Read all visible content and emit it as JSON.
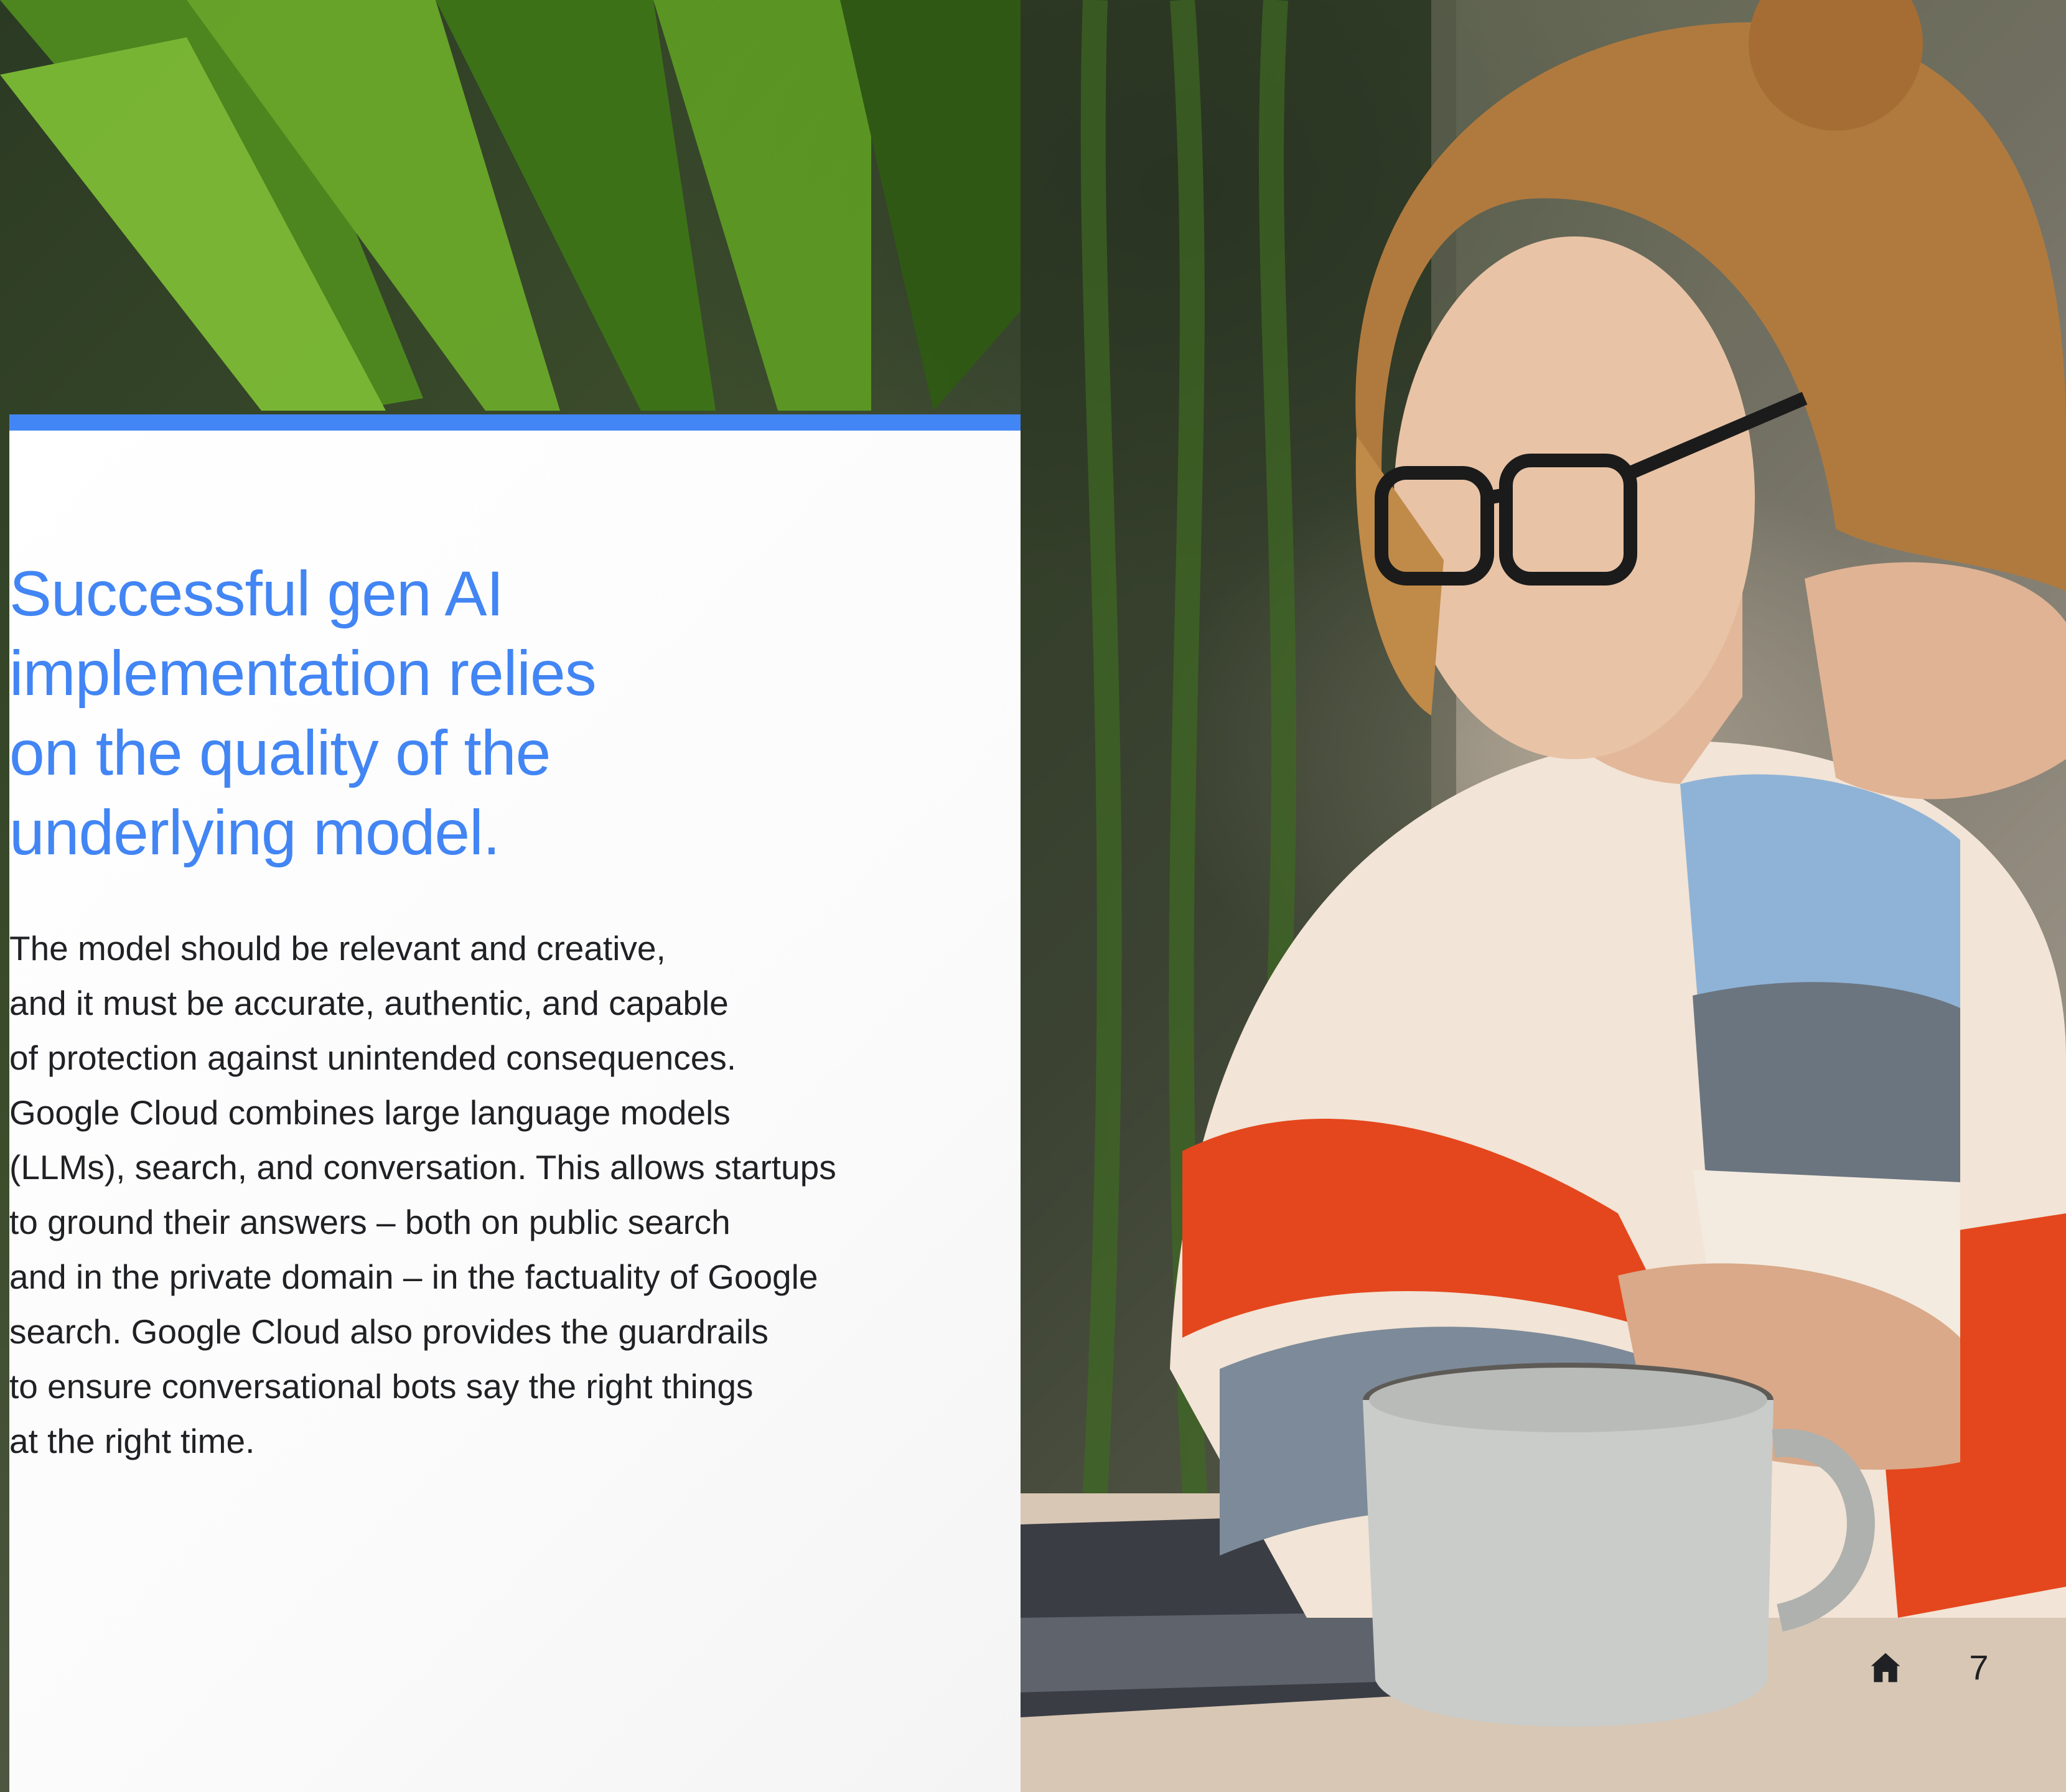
{
  "headline": "Successful gen AI implementation relies on the quality of the underlying model.",
  "headline_lines": [
    "Successful gen AI",
    "implementation relies",
    "on the quality of the",
    "underlying model."
  ],
  "body_lines": [
    "The model should be relevant and creative,",
    "and it must be accurate, authentic, and capable",
    "of protection against unintended consequences.",
    "Google Cloud combines large language models",
    "(LLMs), search, and conversation. This allows startups",
    "to ground their answers – both on public search",
    "and in the private domain – in the factuality of Google",
    "search. Google Cloud also provides the guardrails",
    "to ensure conversational bots say the right things",
    "at the right time."
  ],
  "footer": {
    "home_icon": "home-icon",
    "page_number": "7"
  },
  "colors": {
    "accent": "#4285f4",
    "body_text": "#202124",
    "panel": "#ffffff"
  },
  "photo": {
    "description_icon": "photo-woman-laptop-coffee"
  }
}
